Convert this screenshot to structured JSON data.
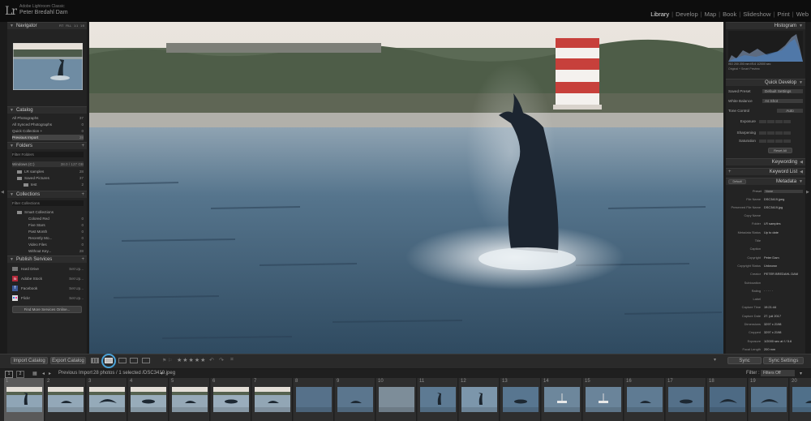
{
  "app": {
    "logo": "Lr",
    "product": "Adobe Lightroom Classic",
    "catalog_owner": "Peter Bredahl Dam"
  },
  "modules": [
    "Library",
    "Develop",
    "Map",
    "Book",
    "Slideshow",
    "Print",
    "Web"
  ],
  "active_module": "Library",
  "left_panel": {
    "navigator": {
      "title": "Navigator",
      "zoom": [
        "FIT",
        "FILL",
        "1:1",
        "1:5"
      ]
    },
    "catalog": {
      "title": "Catalog",
      "items": [
        {
          "label": "All Photographs",
          "count": "37"
        },
        {
          "label": "All Synced Photographs",
          "count": "0"
        },
        {
          "label": "Quick Collection +",
          "count": "0"
        },
        {
          "label": "Previous Import",
          "count": "28"
        }
      ]
    },
    "folders": {
      "title": "Folders",
      "filter": "Filter Folders",
      "volume": {
        "label": "Windows (C:)",
        "info": "38.0 / 127 GB"
      },
      "items": [
        {
          "label": "LR samples",
          "count": "28"
        },
        {
          "label": "Saved Pictures",
          "count": "37"
        },
        {
          "label": "test",
          "count": "2"
        }
      ]
    },
    "collections": {
      "title": "Collections",
      "filter": "Filter Collections",
      "set": "Smart Collections",
      "items": [
        {
          "label": "Colored Red",
          "count": "0"
        },
        {
          "label": "Five Stars",
          "count": "0"
        },
        {
          "label": "Past Month",
          "count": "0"
        },
        {
          "label": "Recently Mo...",
          "count": "0"
        },
        {
          "label": "Video Files",
          "count": "0"
        },
        {
          "label": "Without Key...",
          "count": "28"
        }
      ]
    },
    "publish": {
      "title": "Publish Services",
      "items": [
        {
          "label": "Hard Drive",
          "action": "Set Up..."
        },
        {
          "label": "Adobe Stock",
          "action": "Set Up..."
        },
        {
          "label": "Facebook",
          "action": "Set Up..."
        },
        {
          "label": "Flickr",
          "action": "Set Up..."
        }
      ],
      "find_more": "Find More Services Online..."
    }
  },
  "right_panel": {
    "histogram": {
      "title": "Histogram",
      "info": "ISO 200  200 mm  f/5.6  1/2000 sec",
      "preview": "Original + Smart Preview"
    },
    "quick_develop": {
      "title": "Quick Develop",
      "rows": [
        {
          "label": "Saved Preset",
          "value": "Default Settings"
        },
        {
          "label": "White Balance",
          "value": "As Shot"
        },
        {
          "label": "Tone Control",
          "value": "Auto"
        },
        {
          "label": "Exposure",
          "value": ""
        },
        {
          "label": "Sharpening",
          "value": ""
        },
        {
          "label": "Saturation",
          "value": ""
        }
      ],
      "reset": "Reset All"
    },
    "keywording": {
      "title": "Keywording"
    },
    "keyword_list": {
      "title": "Keyword List"
    },
    "metadata": {
      "title": "Metadata",
      "preset_label": "Default",
      "preset_value": "None",
      "rows": [
        {
          "label": "File Name",
          "value": "DSC3419.jpeg"
        },
        {
          "label": "Preserved File Name",
          "value": "DSC3419.jpg"
        },
        {
          "label": "Copy Name",
          "value": ""
        },
        {
          "label": "Folder",
          "value": "LR samples"
        },
        {
          "label": "Metadata Status",
          "value": "Up to date"
        },
        {
          "label": "Title",
          "value": ""
        },
        {
          "label": "Caption",
          "value": ""
        },
        {
          "label": "Copyright",
          "value": "Peter Dam"
        },
        {
          "label": "Copyright Status",
          "value": "Unknown"
        },
        {
          "label": "Creator",
          "value": "PETER BREDAHL DAM"
        },
        {
          "label": "Sublocation",
          "value": ""
        },
        {
          "label": "Rating",
          "value": "· · · · ·"
        },
        {
          "label": "Label",
          "value": ""
        },
        {
          "label": "Capture Time",
          "value": "19:21:44"
        },
        {
          "label": "Capture Date",
          "value": "27. juli 2017"
        },
        {
          "label": "Dimensions",
          "value": "3297 x 2198"
        },
        {
          "label": "Cropped",
          "value": "3297 x 2198"
        },
        {
          "label": "Exposure",
          "value": "1/2000 sec at f / 5.6"
        },
        {
          "label": "Focal Length",
          "value": "200 mm"
        },
        {
          "label": "ISO Speed Rating",
          "value": "ISO 200"
        },
        {
          "label": "Flash",
          "value": "Did not fire"
        }
      ]
    }
  },
  "toolbar": {
    "import": "Import Catalog",
    "export": "Export Catalog",
    "stars": "★★★★★",
    "sync": "Sync",
    "sync_settings": "Sync Settings"
  },
  "filmstrip_header": {
    "pages": [
      "1",
      "2"
    ],
    "source": "Previous Import",
    "summary": "28 photos / 1 selected /DSC3419.jpeg",
    "filter_label": "Filter :",
    "filter_value": "Filters Off"
  },
  "filmstrip": {
    "numbers": [
      "1",
      "2",
      "3",
      "4",
      "5",
      "6",
      "7",
      "8",
      "9",
      "10",
      "11",
      "12",
      "13",
      "14",
      "15",
      "16",
      "17",
      "18",
      "19",
      "20"
    ],
    "selected_index": 0
  },
  "colors": {
    "accent": "#4aa3d9",
    "panel": "#232323",
    "water": "#3c5a72",
    "sky": "#e8e3dc"
  }
}
